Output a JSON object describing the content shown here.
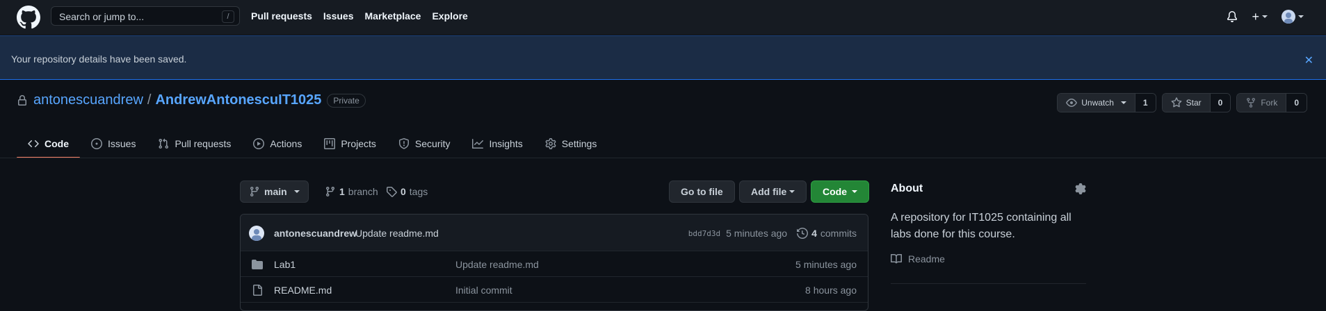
{
  "header": {
    "search_placeholder": "Search or jump to...",
    "search_shortcut": "/",
    "nav": [
      "Pull requests",
      "Issues",
      "Marketplace",
      "Explore"
    ]
  },
  "flash": {
    "message": "Your repository details have been saved.",
    "close_glyph": "✕"
  },
  "repo": {
    "owner": "antonescuandrew",
    "separator": "/",
    "name": "AndrewAntonescuIT1025",
    "visibility": "Private",
    "unwatch_label": "Unwatch",
    "watch_count": "1",
    "star_label": "Star",
    "star_count": "0",
    "fork_label": "Fork",
    "fork_count": "0"
  },
  "tabs": [
    {
      "label": "Code",
      "icon": "code-icon",
      "active": true
    },
    {
      "label": "Issues",
      "icon": "issue-icon"
    },
    {
      "label": "Pull requests",
      "icon": "pull-request-icon"
    },
    {
      "label": "Actions",
      "icon": "play-icon"
    },
    {
      "label": "Projects",
      "icon": "project-icon"
    },
    {
      "label": "Security",
      "icon": "shield-icon"
    },
    {
      "label": "Insights",
      "icon": "graph-icon"
    },
    {
      "label": "Settings",
      "icon": "gear-icon"
    }
  ],
  "branch": {
    "current": "main",
    "branch_count": "1",
    "branch_label": "branch",
    "tag_count": "0",
    "tag_label": "tags",
    "go_to_file": "Go to file",
    "add_file": "Add file",
    "code": "Code"
  },
  "latest_commit": {
    "author": "antonescuandrew",
    "message": "Update readme.md",
    "sha": "bdd7d3d",
    "time": "5 minutes ago",
    "commit_count": "4",
    "commit_label": "commits"
  },
  "files": [
    {
      "type": "folder",
      "name": "Lab1",
      "message": "Update readme.md",
      "time": "5 minutes ago"
    },
    {
      "type": "file",
      "name": "README.md",
      "message": "Initial commit",
      "time": "8 hours ago"
    }
  ],
  "about": {
    "title": "About",
    "description": "A repository for IT1025 containing all labs done for this course.",
    "readme_label": "Readme"
  }
}
